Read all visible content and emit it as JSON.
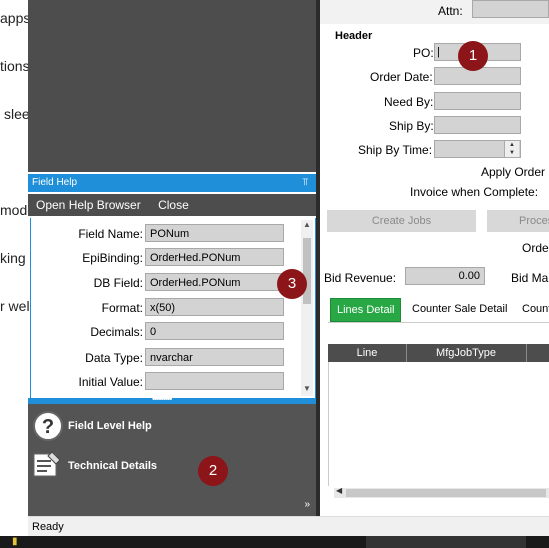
{
  "background_fragments": [
    "apps",
    "tions",
    "slee",
    "mode",
    "king",
    "r wel"
  ],
  "field_help": {
    "title": "Field Help",
    "menu": {
      "open_help_browser": "Open Help Browser",
      "close": "Close"
    },
    "fields": [
      {
        "label": "Field Name:",
        "value": "PONum"
      },
      {
        "label": "EpiBinding:",
        "value": "OrderHed.PONum"
      },
      {
        "label": "DB Field:",
        "value": "OrderHed.PONum"
      },
      {
        "label": "Format:",
        "value": "x(50)"
      },
      {
        "label": "Decimals:",
        "value": "0"
      },
      {
        "label": "Data Type:",
        "value": "nvarchar"
      },
      {
        "label": "Initial Value:",
        "value": ""
      }
    ],
    "links": {
      "field_level_help": "Field Level Help",
      "technical_details": "Technical Details"
    }
  },
  "form": {
    "attn_label": "Attn:",
    "header_title": "Header",
    "po_label": "PO:",
    "po_value": "|",
    "order_date_label": "Order Date:",
    "need_by_label": "Need By:",
    "ship_by_label": "Ship By:",
    "ship_by_time_label": "Ship By Time:",
    "apply_order_label": "Apply Order I",
    "invoice_when_complete_label": "Invoice when Complete:",
    "create_jobs_button": "Create Jobs",
    "process_button": "Proces",
    "order_label": "Orde",
    "bid_revenue_label": "Bid Revenue:",
    "bid_revenue_value": "0.00",
    "bid_margin_label": "Bid Ma"
  },
  "tabs": [
    {
      "label": "Lines Detail",
      "active": true
    },
    {
      "label": "Counter Sale Detail",
      "active": false
    },
    {
      "label": "Count",
      "active": false
    }
  ],
  "grid": {
    "columns": [
      "Line",
      "MfgJobType"
    ]
  },
  "status": {
    "text": "Ready"
  },
  "markers": [
    "1",
    "2",
    "3"
  ],
  "colors": {
    "accent": "#1e8fd8",
    "active_tab": "#27a844",
    "marker": "#8b1518",
    "panel_dark": "#4d4d4d"
  }
}
